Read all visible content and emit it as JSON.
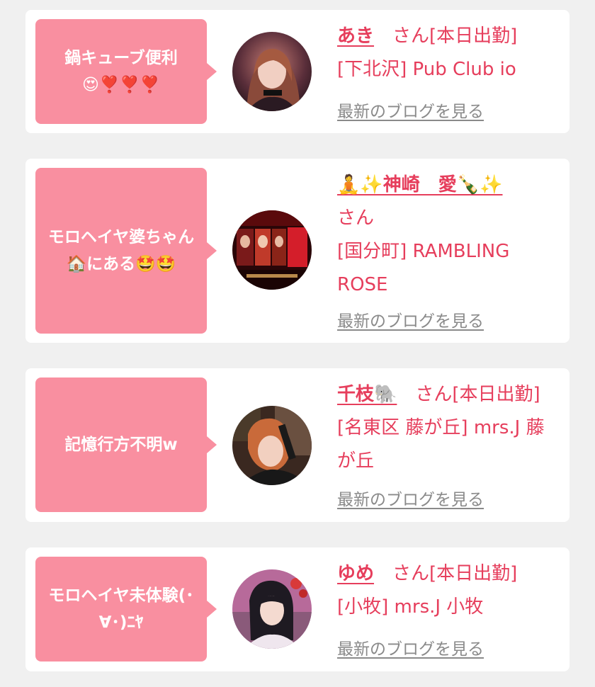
{
  "colors": {
    "background": "#f0f0f0",
    "card": "#ffffff",
    "bubble": "#f98fa0",
    "accent": "#e63e5c",
    "link_gray": "#8a8a8a"
  },
  "posts": [
    {
      "comment": "鍋キューブ便利😍❣️❣️❣️",
      "name": "あき",
      "meta_line1": "さん[本日出勤]",
      "meta_line2": "[下北沢] Pub Club io",
      "blog_link": "最新のブログを見る",
      "avatar_icon": "profile-photo"
    },
    {
      "comment": "モロヘイヤ婆ちゃん🏠にある🤩🤩",
      "name": "🧘✨神崎　愛🍾✨",
      "meta_line1": "さん",
      "meta_line2": "[国分町] RAMBLING ROSE",
      "blog_link": "最新のブログを見る",
      "avatar_icon": "event-banner-photo"
    },
    {
      "comment": "記憶行方不明w",
      "name": "千枝🐘",
      "meta_line1": "さん[本日出勤]",
      "meta_line2": "[名東区 藤が丘] mrs.J 藤が丘",
      "blog_link": "最新のブログを見る",
      "avatar_icon": "profile-photo"
    },
    {
      "comment": "モロヘイヤ未体験(･∀･)ﾆﾔ",
      "name": "ゆめ",
      "meta_line1": "さん[本日出勤]",
      "meta_line2": "[小牧] mrs.J 小牧",
      "blog_link": "最新のブログを見る",
      "avatar_icon": "profile-photo"
    }
  ]
}
